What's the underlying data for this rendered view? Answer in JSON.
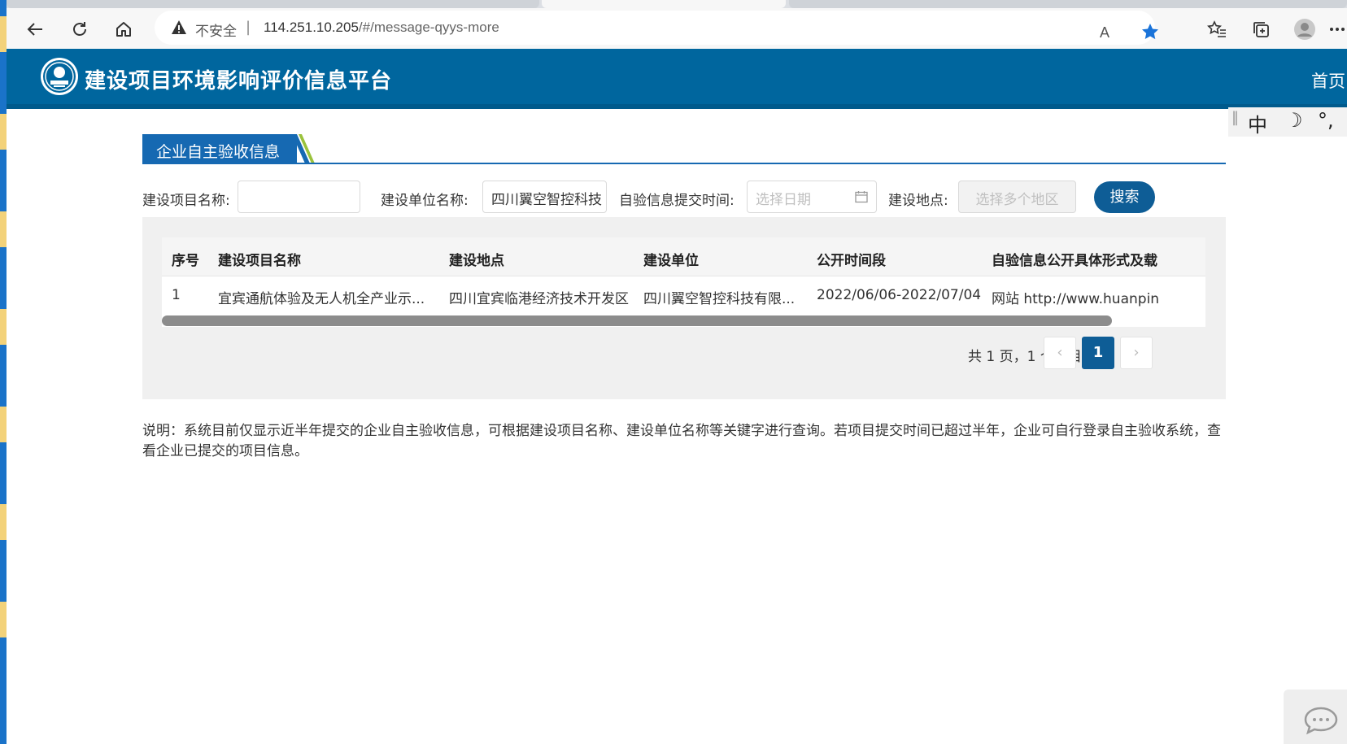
{
  "browser": {
    "security_text": "不安全",
    "separator": "|",
    "url_host": "114.251.10.205",
    "url_path": "/#/message-qyys-more",
    "read_aloud_label": "A"
  },
  "site": {
    "title": "建设项目环境影响评价信息平台",
    "nav_home": "首页"
  },
  "ime": {
    "mode": "中",
    "moon": "☽",
    "punct": "°,"
  },
  "section": {
    "title": "企业自主验收信息"
  },
  "search": {
    "project_name_label": "建设项目名称:",
    "project_name_value": "",
    "unit_name_label": "建设单位名称:",
    "unit_name_value": "四川翼空智控科技",
    "submit_time_label": "自验信息提交时间:",
    "submit_time_placeholder": "选择日期",
    "location_label": "建设地点:",
    "location_placeholder": "选择多个地区",
    "search_button": "搜索"
  },
  "table": {
    "columns": [
      "序号",
      "建设项目名称",
      "建设地点",
      "建设单位",
      "公开时间段",
      "自验信息公开具体形式及载"
    ],
    "rows": [
      {
        "index": "1",
        "project_name": "宜宾通航体验及无人机全产业示...",
        "location": "四川宜宾临港经济技术开发区",
        "unit": "四川翼空智控科技有限...",
        "period": "2022/06/06-2022/07/04",
        "form": "网站 http://www.huanpin"
      }
    ]
  },
  "pagination": {
    "summary": "共 1 页，1 个项目",
    "prev": "‹",
    "current": "1",
    "next": "›"
  },
  "note": "说明：系统目前仅显示近半年提交的企业自主验收信息，可根据建设项目名称、建设单位名称等关键字进行查询。若项目提交时间已超过半年，企业可自行登录自主验收系统，查看企业已提交的项目信息。"
}
